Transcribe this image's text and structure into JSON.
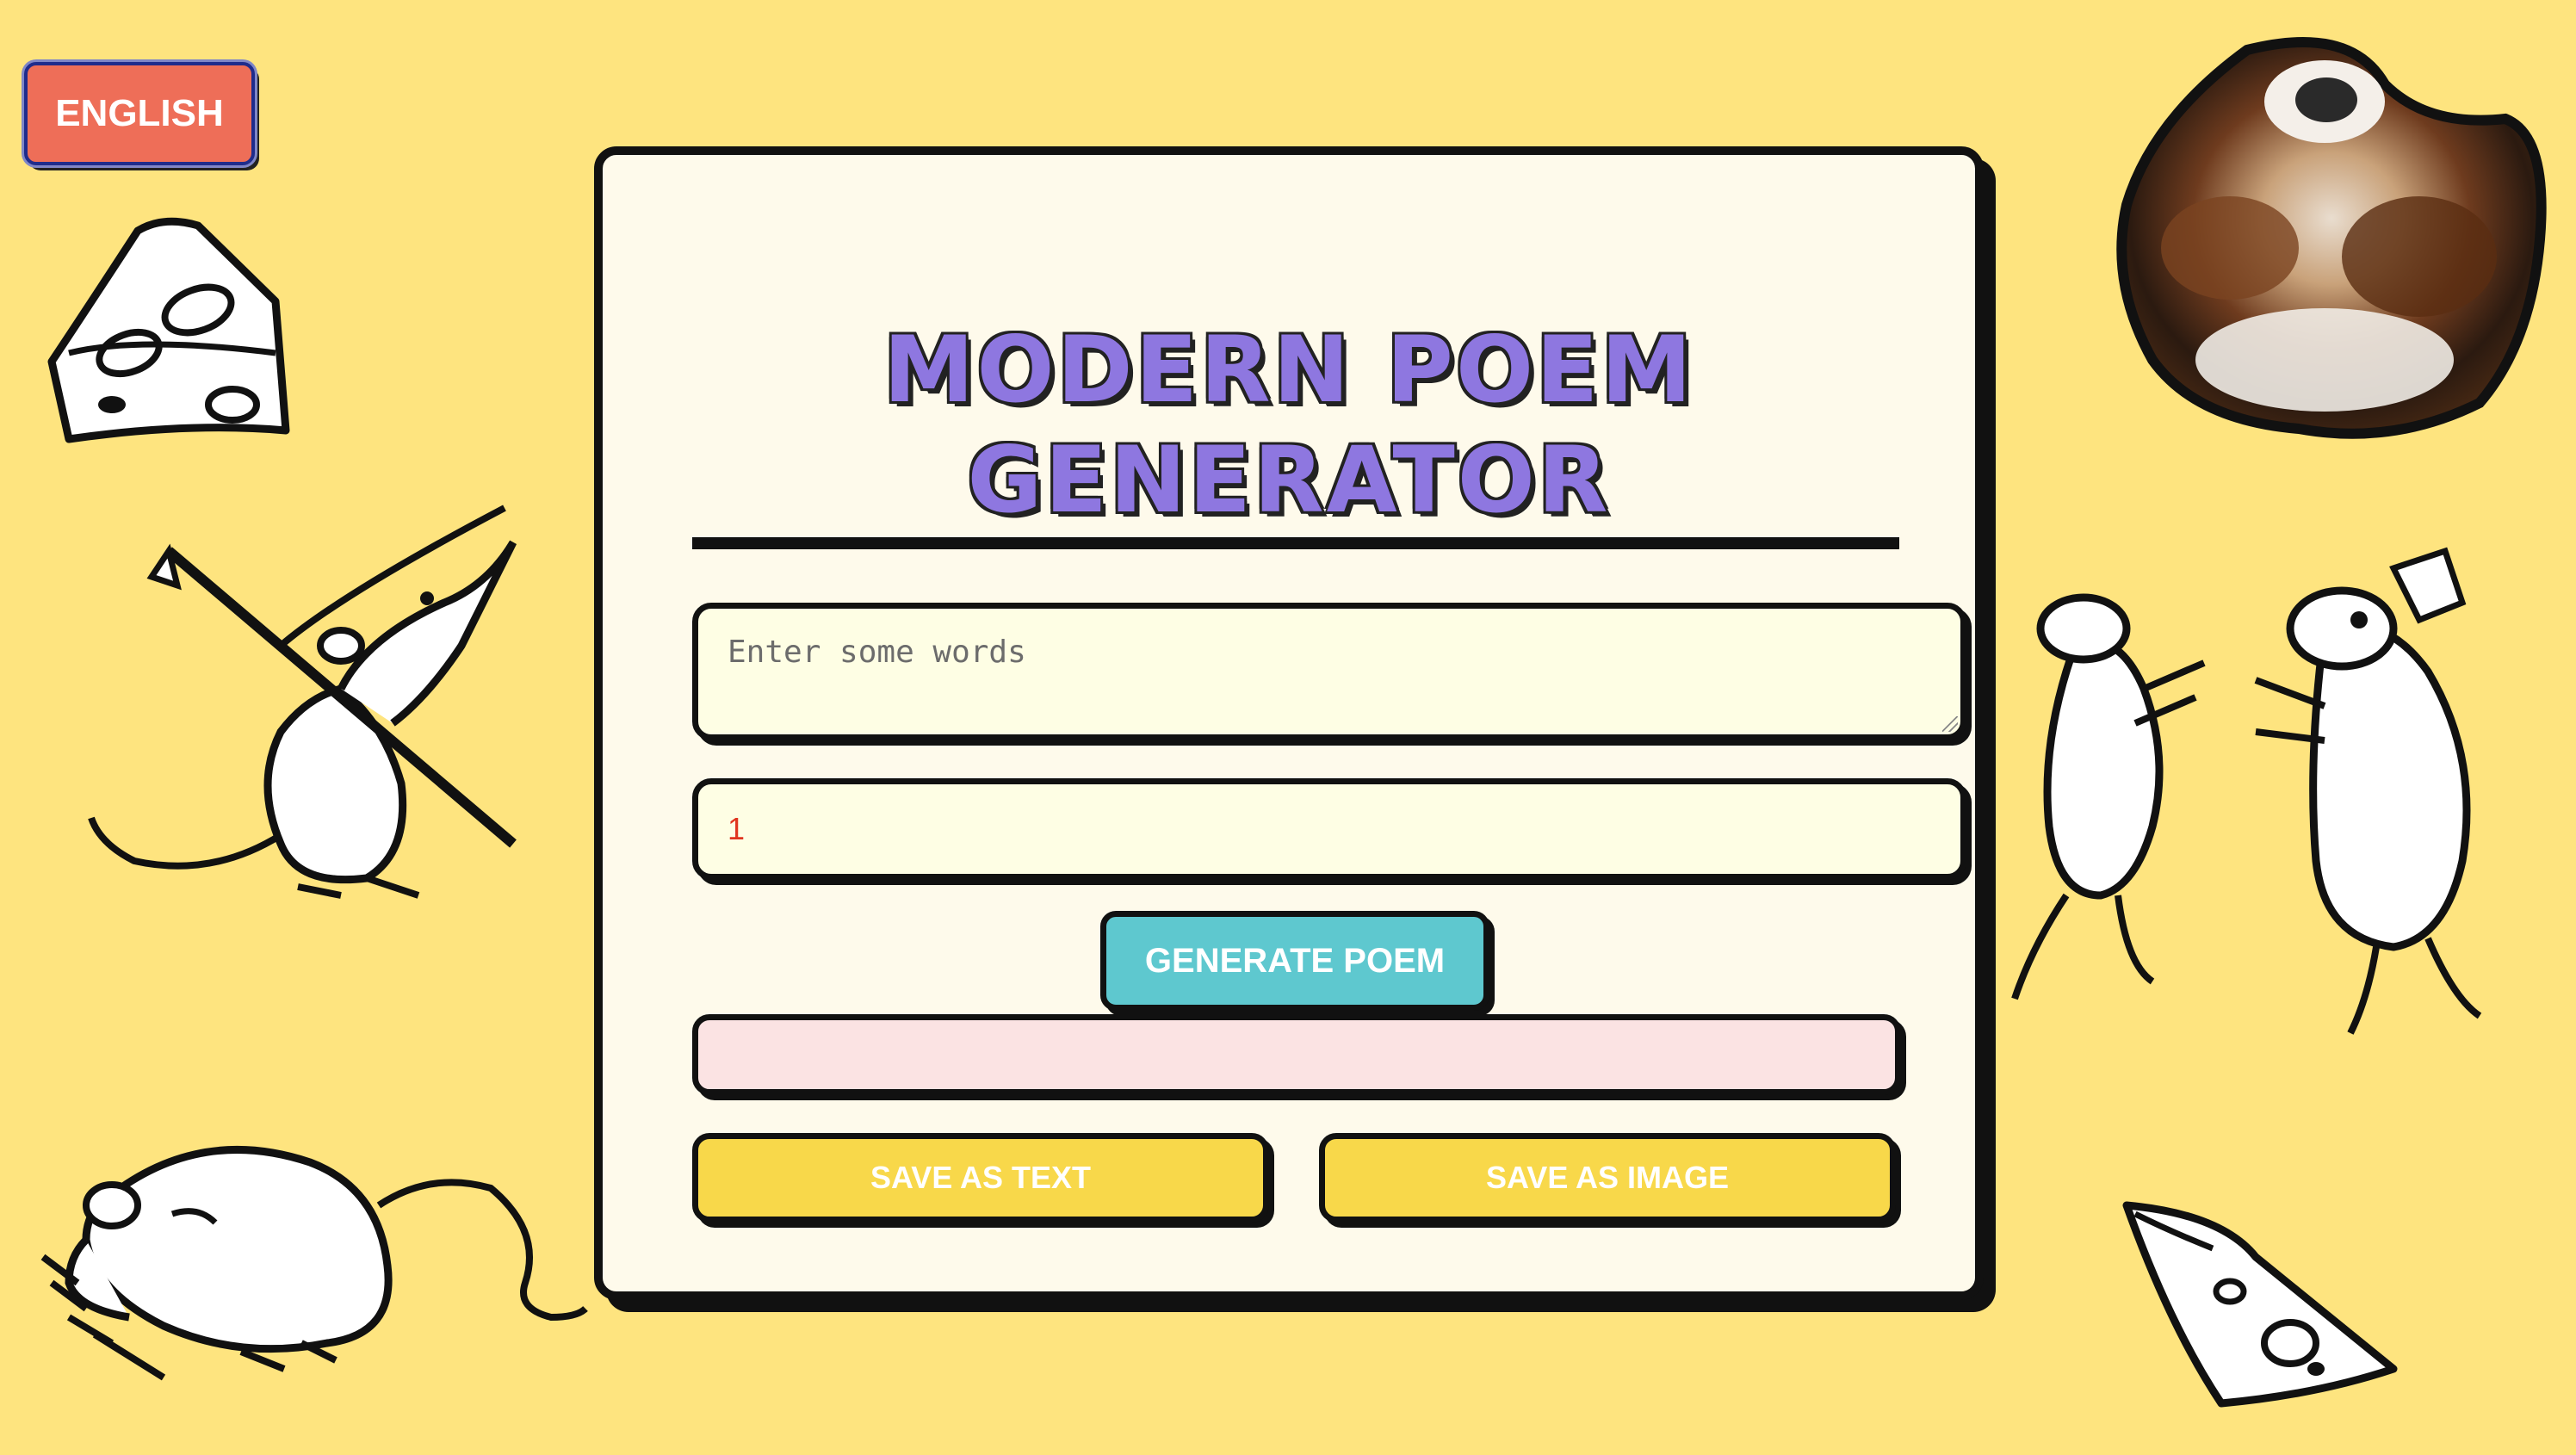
{
  "language_button": {
    "label": "ENGLISH"
  },
  "app": {
    "title": "MODERN POEM GENERATOR"
  },
  "form": {
    "words_placeholder": "Enter some words",
    "words_value": "",
    "count_value": "1",
    "generate_label": "GENERATE POEM",
    "output_text": ""
  },
  "actions": {
    "save_text_label": "SAVE AS TEXT",
    "save_image_label": "SAVE AS IMAGE"
  },
  "colors": {
    "background": "#fee47f",
    "card": "#fefaeb",
    "title": "#8e77e0",
    "language_button": "#ee6e58",
    "generate_button": "#5ec8cf",
    "save_buttons": "#f8d84a",
    "output_box": "#fbe3e3",
    "count_text": "#e0341e"
  },
  "decorations": [
    "cheese-drawing",
    "rat-with-spear-drawing",
    "crouching-rat-drawing",
    "dog-photo",
    "dancing-rats-drawing",
    "cheese-slice-drawing"
  ]
}
